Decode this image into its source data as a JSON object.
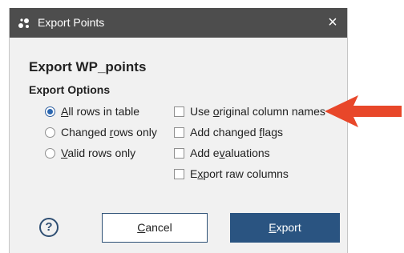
{
  "dialog": {
    "title": "Export Points",
    "close_glyph": "×",
    "heading": "Export WP_points",
    "options_label": "Export Options"
  },
  "radios": [
    {
      "pre": "",
      "key": "A",
      "post": "ll rows in table",
      "checked": true
    },
    {
      "pre": "Changed ",
      "key": "r",
      "post": "ows only",
      "checked": false
    },
    {
      "pre": "",
      "key": "V",
      "post": "alid rows only",
      "checked": false
    }
  ],
  "checkboxes": [
    {
      "pre": "Use ",
      "key": "o",
      "post": "riginal column names",
      "checked": false
    },
    {
      "pre": "Add changed ",
      "key": "f",
      "post": "lags",
      "checked": false
    },
    {
      "pre": "Add e",
      "key": "v",
      "post": "aluations",
      "checked": false
    },
    {
      "pre": "E",
      "key": "x",
      "post": "port raw columns",
      "checked": false
    }
  ],
  "buttons": {
    "help_glyph": "?",
    "cancel": {
      "pre": "",
      "key": "C",
      "post": "ancel"
    },
    "export": {
      "pre": "",
      "key": "E",
      "post": "xport"
    }
  },
  "colors": {
    "titlebar": "#4d4d4d",
    "dialog_bg": "#f1f1f1",
    "primary_button": "#2a5481",
    "annotation_arrow": "#e8472a"
  },
  "icons": {
    "app": "leapfrog-app-icon",
    "close": "close-icon",
    "help": "help-icon",
    "arrow": "annotation-arrow-icon"
  }
}
